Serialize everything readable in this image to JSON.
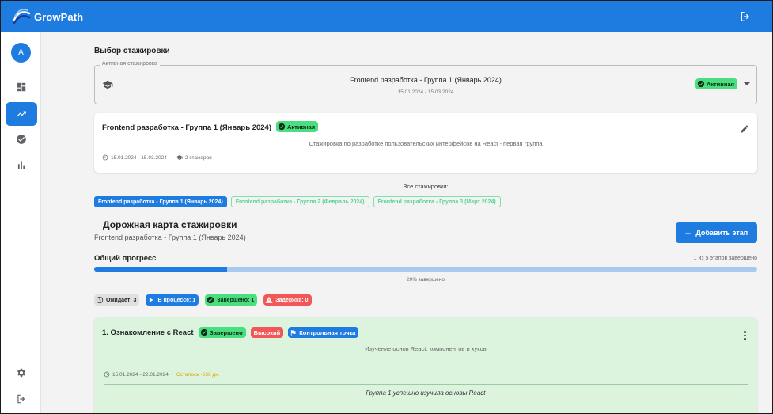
{
  "app": {
    "name": "GrowPath"
  },
  "sidebar": {
    "avatar_initial": "A",
    "items": [
      {
        "name": "dashboard",
        "icon": "dashboard-icon",
        "active": false
      },
      {
        "name": "progress",
        "icon": "trending-up-icon",
        "active": true
      },
      {
        "name": "tasks",
        "icon": "check-circle-icon",
        "active": false
      },
      {
        "name": "analytics",
        "icon": "bar-chart-icon",
        "active": false
      }
    ],
    "bottom": [
      {
        "name": "settings",
        "icon": "gear-icon"
      },
      {
        "name": "logout",
        "icon": "logout-icon"
      }
    ]
  },
  "selection": {
    "title": "Выбор стажировки",
    "legend": "Активная стажировка",
    "current_name": "Frontend разработка - Группа 1 (Январь 2024)",
    "current_dates": "15.01.2024 - 15.03.2024",
    "status": "Активная"
  },
  "internship_card": {
    "title": "Frontend разработка - Группа 1 (Январь 2024)",
    "status": "Активная",
    "description": "Стажировка по разработке пользовательских интерфейсов на React - первая группа",
    "dates": "15.01.2024 - 15.03.2024",
    "interns": "2 стажеров"
  },
  "all_internships": {
    "label": "Все стажировки:",
    "tabs": [
      {
        "label": "Frontend разработка - Группа 1 (Январь 2024)",
        "active": true
      },
      {
        "label": "Frontend разработка - Группа 2 (Февраль 2024)",
        "active": false
      },
      {
        "label": "Frontend разработка - Группа 3 (Март 2024)",
        "active": false
      }
    ]
  },
  "roadmap": {
    "title": "Дорожная карта стажировки",
    "subtitle": "Frontend разработка - Группа 1 (Январь 2024)",
    "add_button": "Добавить этап",
    "progress_label": "Общий прогресс",
    "progress_summary": "1 из 5 этапов завершено",
    "progress_fraction": 0.2,
    "progress_text": "20% завершено",
    "stats": {
      "waiting": "Ожидает: 3",
      "in_progress": "В процессе: 1",
      "done": "Завершено: 1",
      "delayed": "Задержка: 0"
    }
  },
  "stage": {
    "title": "1. Ознакомление с React",
    "status": "Завершено",
    "priority": "Высокий",
    "checkpoint": "Контрольная точка",
    "description": "Изучение основ React, компонентов и хуков",
    "dates": "15.01.2024 - 22.01.2024",
    "remaining": "Осталось -636 дн.",
    "note": "Группа 1 успешно изучила основы React"
  },
  "colors": {
    "primary": "#1e7be0",
    "success": "#4ade80",
    "danger": "#f25757",
    "warning": "#e0a400",
    "stage_bg": "#dcf4dd"
  }
}
